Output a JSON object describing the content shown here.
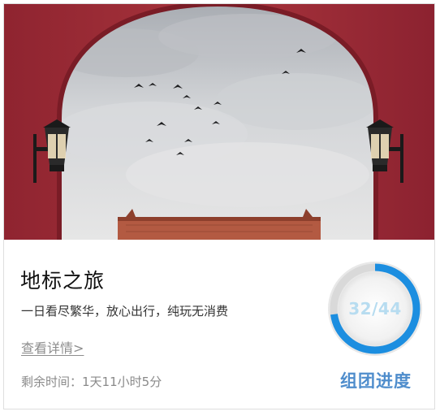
{
  "card": {
    "title": "地标之旅",
    "subtitle": "一日看尽繁华，放心出行，纯玩无消费",
    "details_link": "查看详情>",
    "time_left_label": "剩余时间：",
    "time_left_value": "1天11小时5分"
  },
  "progress": {
    "current": 32,
    "total": 44,
    "text": "32/44",
    "label": "组团进度",
    "ring_color": "#1c8ee0",
    "ring_track_color": "#d9d9d9",
    "label_color": "#4f8dcc"
  },
  "hero_image": {
    "icon": "forbidden-city-arch-photo",
    "wall_color": "#a83038",
    "sky_color": "#c9ccd0",
    "roof_color": "#b55a40"
  }
}
